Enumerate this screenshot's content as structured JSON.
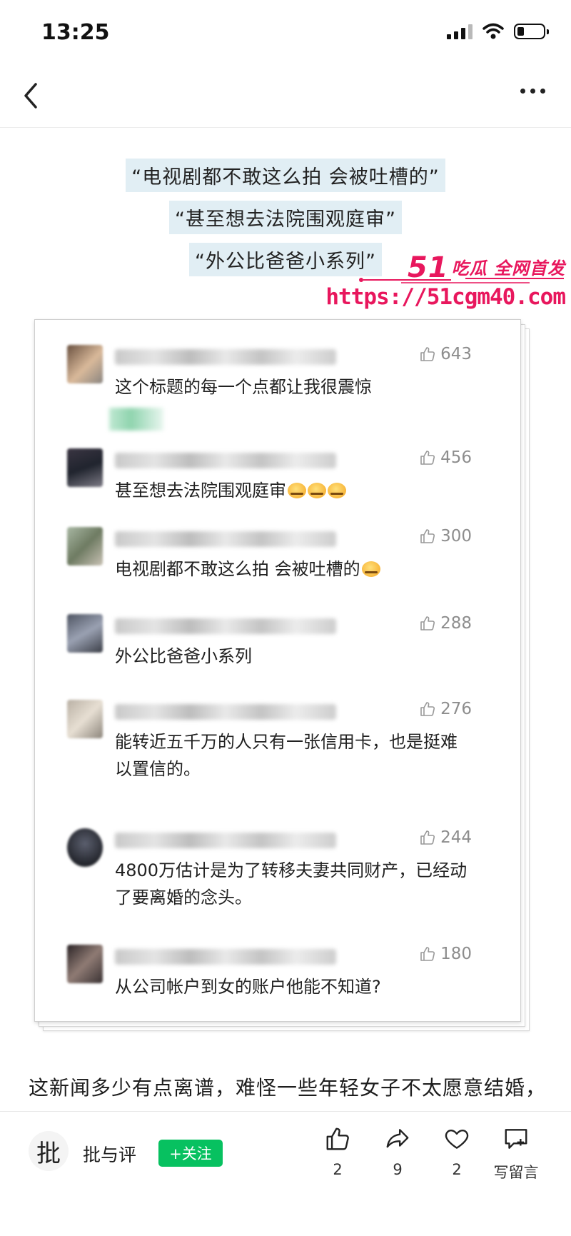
{
  "status_bar": {
    "time": "13:25",
    "icons": [
      "signal-icon",
      "wifi-icon",
      "battery-icon"
    ]
  },
  "nav": {
    "back_icon": "chevron-left-icon",
    "more_icon": "more-dots-icon"
  },
  "quotes": [
    "“电视剧都不敢这么拍 会被吐槽的”",
    "“甚至想去法院围观庭审”",
    "“外公比爸爸小系列”"
  ],
  "watermark": {
    "brand_number": "51",
    "brand_text": "吃瓜 全网首发",
    "url": "https://51cgm40.com",
    "color": "#e8175d"
  },
  "comments": [
    {
      "text": "这个标题的每一个点都让我很震惊",
      "likes": "643"
    },
    {
      "text": "甚至想去法院围观庭审",
      "likes": "456",
      "emoji_count": 3
    },
    {
      "text": "电视剧都不敢这么拍 会被吐槽的",
      "likes": "300",
      "emoji_count": 1
    },
    {
      "text": "外公比爸爸小系列",
      "likes": "288"
    },
    {
      "text": "能转近五千万的人只有一张信用卡，也是挺难以置信的。",
      "likes": "276"
    },
    {
      "text": "4800万估计是为了转移夫妻共同财产，已经动了要离婚的念头。",
      "likes": "244"
    },
    {
      "text": "从公司帐户到女的账户他能不知道?",
      "likes": "180"
    }
  ],
  "article": {
    "text": "这新闻多少有点离谱，难怪一些年轻女子不太愿意结婚，"
  },
  "bottom_bar": {
    "author_avatar_char": "批",
    "author_name": "批与评",
    "follow_label": "+关注",
    "follow_color": "#07c160",
    "actions": [
      {
        "icon": "thumbs-up-icon",
        "label": "2"
      },
      {
        "icon": "share-icon",
        "label": "9"
      },
      {
        "icon": "heart-icon",
        "label": "2"
      },
      {
        "icon": "comment-icon",
        "label": "写留言"
      }
    ]
  }
}
